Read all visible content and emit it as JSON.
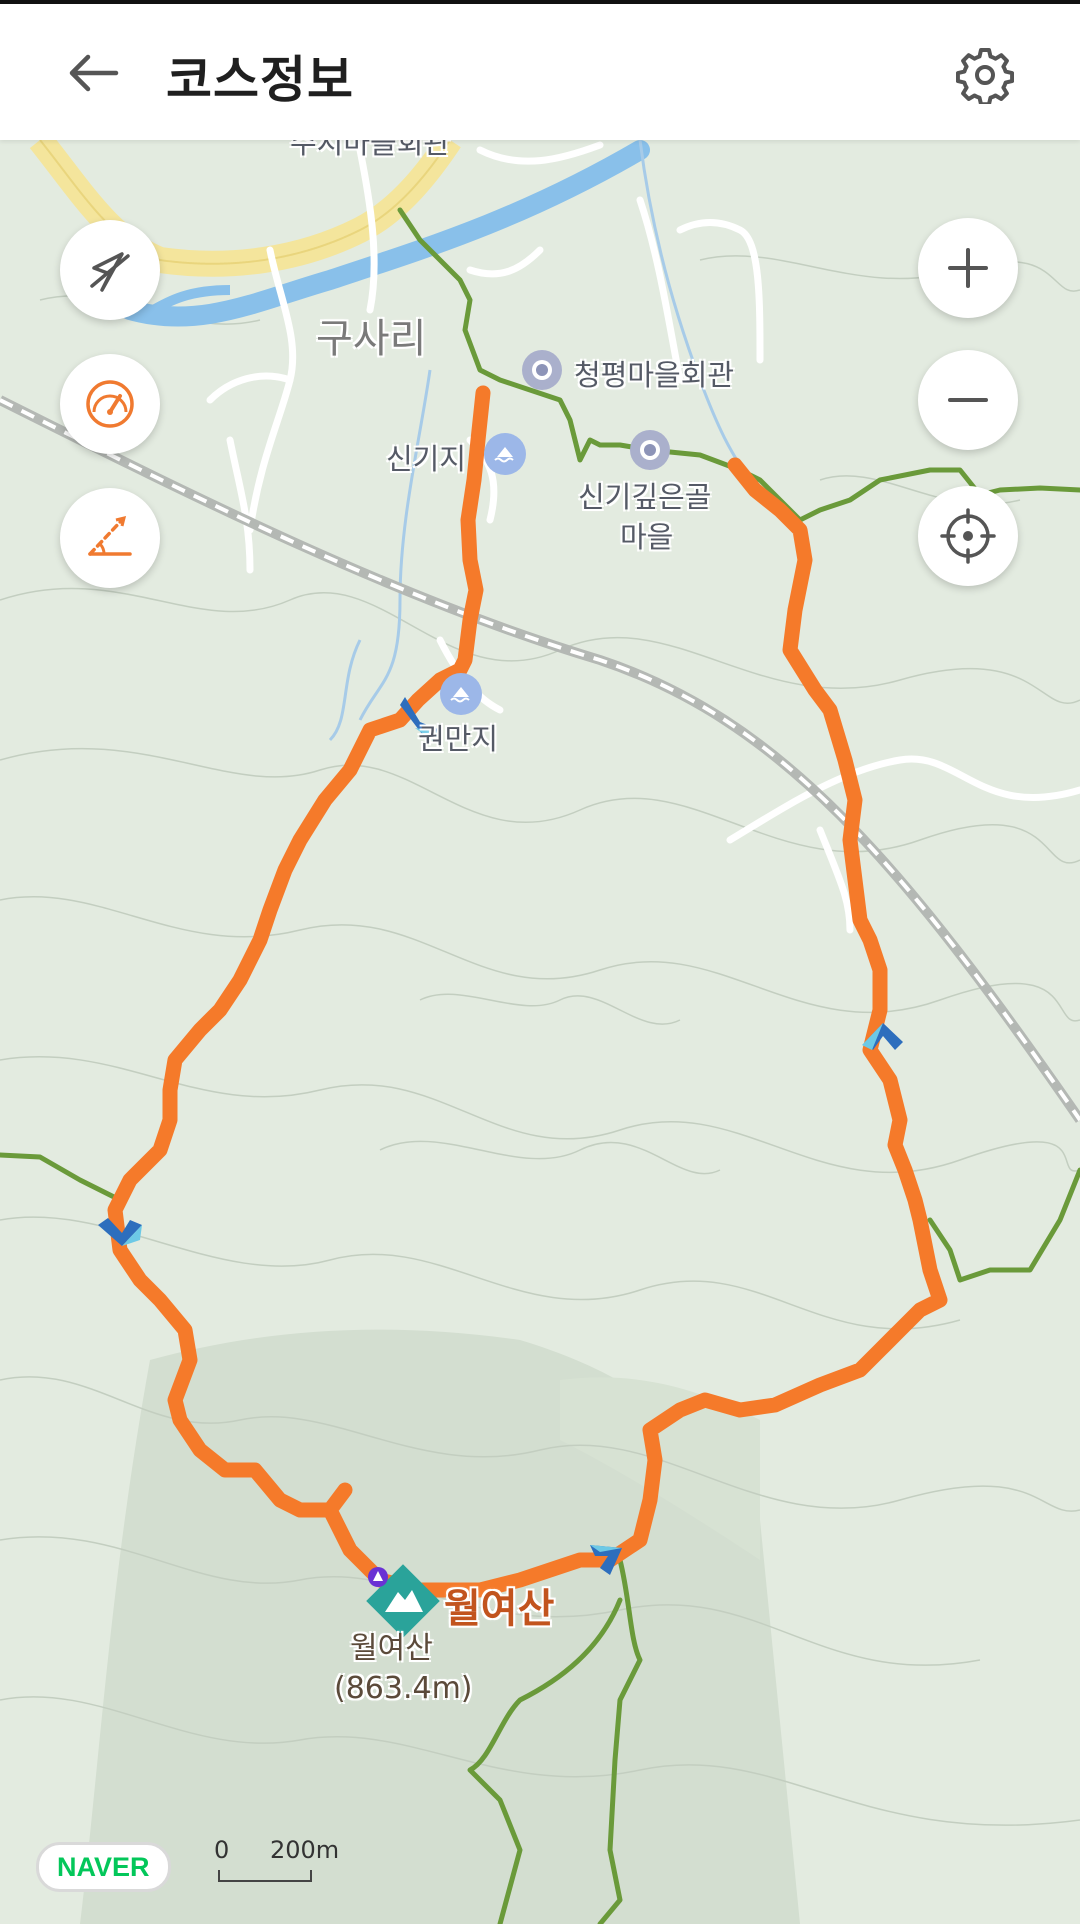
{
  "header": {
    "title": "코스정보"
  },
  "icons": {
    "back": "arrow-left-icon",
    "settings": "gear-icon",
    "compass_off": "compass-off-icon",
    "speedometer": "speedometer-icon",
    "slope": "slope-icon",
    "zoom_in": "plus-icon",
    "zoom_out": "minus-icon",
    "locate": "crosshair-icon"
  },
  "map": {
    "labels": {
      "town": "구사리",
      "top_cut": "수지마을회관",
      "poi_hall": "청평마을회관",
      "poi_village_1": "신기깊은골",
      "poi_village_2": "마을",
      "reservoir_1": "신기지",
      "reservoir_2": "권만지",
      "peak_big": "월여산",
      "peak_name": "월여산",
      "peak_elev": "(863.4m)"
    },
    "brand": "NAVER",
    "scale": {
      "zero": "0",
      "distance": "200m"
    }
  },
  "colors": {
    "route": "#f57a2a",
    "trail": "#6a9a3a",
    "river": "#89c0ea",
    "road": "#f4e59c",
    "map_bg": "#e3ebe0",
    "naver": "#03c75a",
    "icon_orange": "#f07a30"
  }
}
